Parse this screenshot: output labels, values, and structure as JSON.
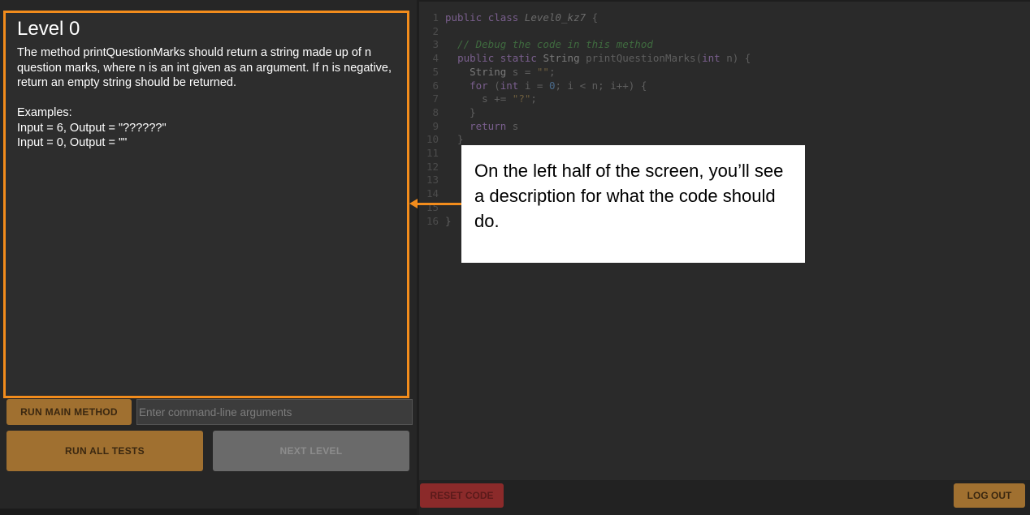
{
  "problem": {
    "title": "Level 0",
    "description": "The method printQuestionMarks should return a string made up of n question marks, where n is an int given as an argument. If n is negative, return an empty string should be returned.\n\nExamples:\nInput = 6, Output = \"??????\"\nInput = 0, Output = \"\""
  },
  "controls": {
    "run_main_label": "RUN MAIN METHOD",
    "args_placeholder": "Enter command-line arguments",
    "run_all_label": "RUN ALL TESTS",
    "next_level_label": "NEXT LEVEL",
    "reset_label": "RESET CODE",
    "logout_label": "LOG OUT"
  },
  "editor": {
    "lines": [
      {
        "n": "1",
        "code": "public class Level0_kz7 {"
      },
      {
        "n": "2",
        "code": ""
      },
      {
        "n": "3",
        "code": "  // Debug the code in this method"
      },
      {
        "n": "4",
        "code": "  public static String printQuestionMarks(int n) {"
      },
      {
        "n": "5",
        "code": "    String s = \"\";"
      },
      {
        "n": "6",
        "code": "    for (int i = 0; i < n; i++) {"
      },
      {
        "n": "7",
        "code": "      s += \"?\";"
      },
      {
        "n": "8",
        "code": "    }"
      },
      {
        "n": "9",
        "code": "    return s"
      },
      {
        "n": "10",
        "code": "  }"
      },
      {
        "n": "11",
        "code": ""
      },
      {
        "n": "12",
        "code": ""
      },
      {
        "n": "13",
        "code": ""
      },
      {
        "n": "14",
        "code": ""
      },
      {
        "n": "15",
        "code": ""
      },
      {
        "n": "16",
        "code": "}"
      }
    ]
  },
  "callout": {
    "text": "On the left half of the screen, you’ll see a description for what the code should do."
  },
  "colors": {
    "accent": "#f28c1c",
    "button": "#a07030",
    "reset": "#8b2a2a"
  }
}
